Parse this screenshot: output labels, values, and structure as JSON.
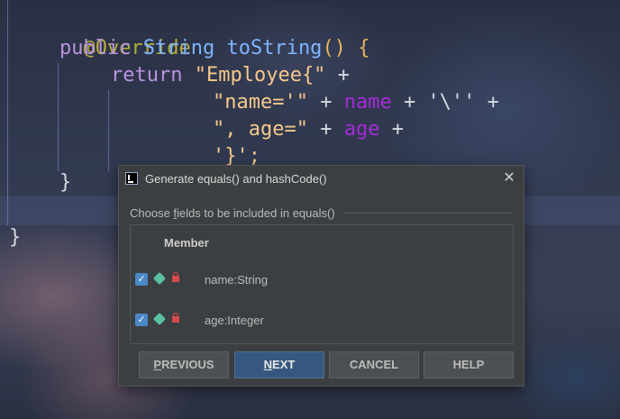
{
  "editor": {
    "lines": [
      {
        "text": "@Override"
      },
      {
        "keyword": "public",
        "type": "String",
        "method": "toString",
        "rest": "() {"
      },
      {
        "keyword": "return",
        "str": "\"Employee{\"",
        "rest": " +"
      },
      {
        "str": "\"name='\"",
        "op": " + ",
        "field": "name",
        "rest": " + '\\'' +"
      },
      {
        "str": "\", age=\"",
        "op": " + ",
        "field": "age",
        "rest": " +"
      },
      {
        "str": "'}';"
      },
      {
        "brace": "}"
      },
      {
        "brace": "}"
      }
    ]
  },
  "dialog": {
    "title": "Generate equals() and hashCode()",
    "section_label_prefix": "Choose ",
    "section_label_mnemonic": "f",
    "section_label_suffix": "ields to be included in equals()",
    "column_header": "Member",
    "rows": [
      {
        "label": "name:String",
        "checked": true
      },
      {
        "label": "age:Integer",
        "checked": true
      }
    ],
    "buttons": {
      "previous": {
        "mnemonic": "P",
        "rest": "REVIOUS"
      },
      "next": {
        "mnemonic": "N",
        "rest": "EXT"
      },
      "cancel": "CANCEL",
      "help": "HELP"
    }
  },
  "colors": {
    "accent": "#365880",
    "checkbox": "#4a88c7",
    "field": "#a52bd8",
    "annotation": "#b3ae3c",
    "string": "#f4c98a"
  },
  "icons": [
    "app-icon",
    "close-icon",
    "check-icon",
    "field-tag-icon",
    "private-lock-icon"
  ]
}
